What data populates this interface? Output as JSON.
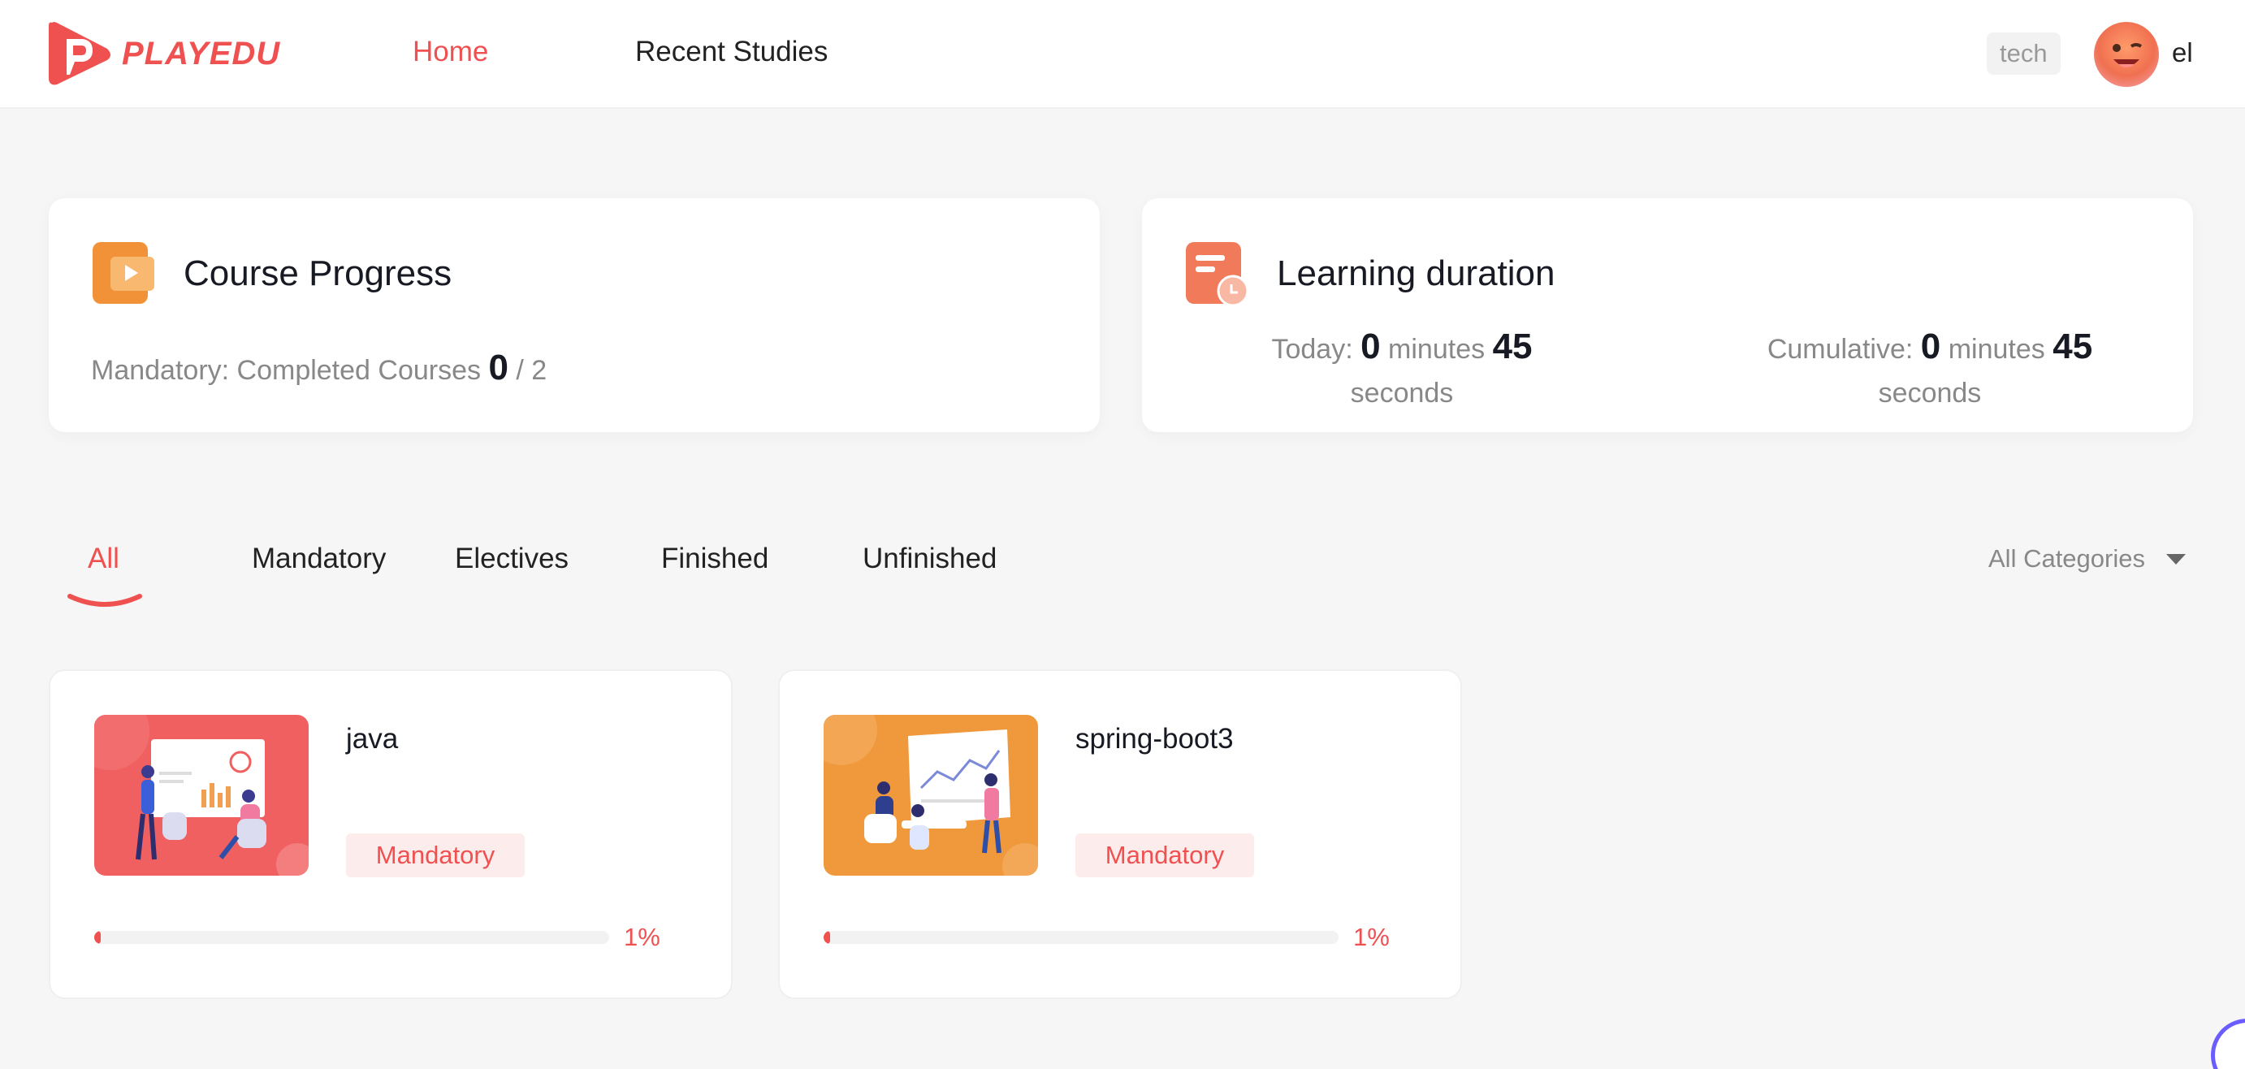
{
  "header": {
    "brand": "PLAYEDU",
    "nav": [
      {
        "label": "Home",
        "active": true
      },
      {
        "label": "Recent Studies",
        "active": false
      }
    ],
    "department": "tech",
    "user_name": "el",
    "accent_color": "#ef5151"
  },
  "course_progress": {
    "title": "Course Progress",
    "label": "Mandatory: Completed Courses",
    "completed": "0",
    "total": "/ 2"
  },
  "learning_duration": {
    "title": "Learning duration",
    "today": {
      "label": "Today:",
      "minutes": "0",
      "minutes_unit": "minutes",
      "seconds": "45",
      "seconds_unit": "seconds"
    },
    "cumulative": {
      "label": "Cumulative:",
      "minutes": "0",
      "minutes_unit": "minutes",
      "seconds": "45",
      "seconds_unit": "seconds"
    }
  },
  "tabs": [
    {
      "label": "All",
      "active": true
    },
    {
      "label": "Mandatory",
      "active": false
    },
    {
      "label": "Electives",
      "active": false
    },
    {
      "label": "Finished",
      "active": false
    },
    {
      "label": "Unfinished",
      "active": false
    }
  ],
  "category_select": {
    "value": "All Categories"
  },
  "courses": [
    {
      "name": "java",
      "tag": "Mandatory",
      "progress": 1,
      "progress_label": "1%",
      "thumb_color": "#f06060"
    },
    {
      "name": "spring-boot3",
      "tag": "Mandatory",
      "progress": 1,
      "progress_label": "1%",
      "thumb_color": "#f0983c"
    }
  ]
}
